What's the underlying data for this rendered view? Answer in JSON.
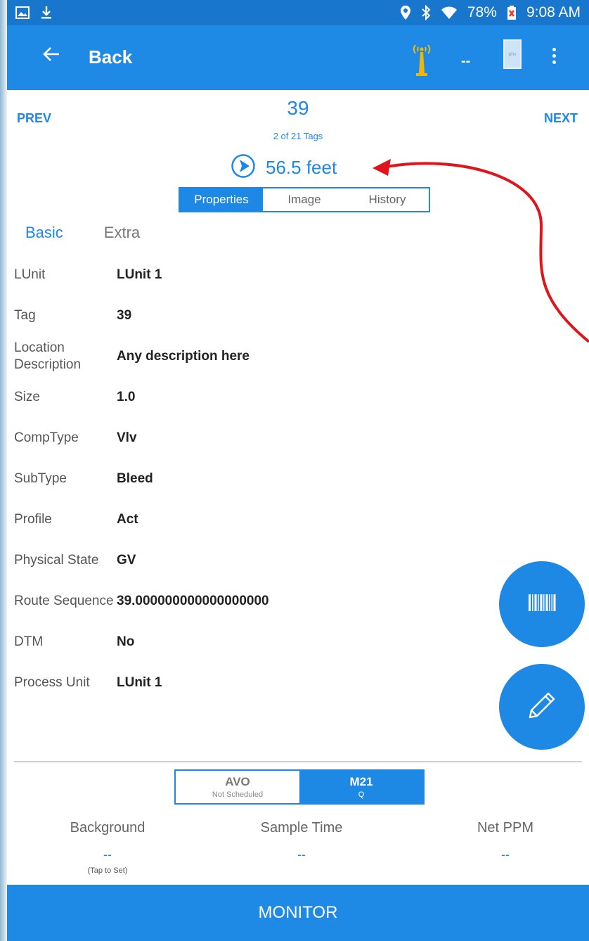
{
  "status": {
    "battery": "78%",
    "time": "9:08 AM"
  },
  "appbar": {
    "back_label": "Back",
    "signal_value": "--",
    "doc_label": "phx"
  },
  "navigator": {
    "prev_label": "PREV",
    "next_label": "NEXT",
    "tag_number": "39",
    "tag_count": "2 of 21 Tags",
    "distance": "56.5 feet"
  },
  "tabs": [
    {
      "label": "Properties",
      "active": true
    },
    {
      "label": "Image",
      "active": false
    },
    {
      "label": "History",
      "active": false
    }
  ],
  "subtabs": {
    "basic": "Basic",
    "extra": "Extra"
  },
  "properties": [
    {
      "label": "LUnit",
      "value": "LUnit 1"
    },
    {
      "label": "Tag",
      "value": "39"
    },
    {
      "label": "Location Description",
      "value": "Any description here"
    },
    {
      "label": "Size",
      "value": "1.0"
    },
    {
      "label": "CompType",
      "value": "Vlv"
    },
    {
      "label": "SubType",
      "value": "Bleed"
    },
    {
      "label": "Profile",
      "value": "Act"
    },
    {
      "label": "Physical State",
      "value": "GV"
    },
    {
      "label": "Route Sequence",
      "value": "39.000000000000000000"
    },
    {
      "label": "DTM",
      "value": "No"
    },
    {
      "label": "Process Unit",
      "value": "LUnit 1"
    }
  ],
  "methods": [
    {
      "name": "AVO",
      "sub": "Not Scheduled",
      "active": false
    },
    {
      "name": "M21",
      "sub": "Q",
      "active": true
    }
  ],
  "metrics": {
    "background_label": "Background",
    "background_value": "--",
    "background_hint": "(Tap to Set)",
    "sample_time_label": "Sample Time",
    "sample_time_value": "--",
    "net_ppm_label": "Net PPM",
    "net_ppm_value": "--"
  },
  "monitor_label": "MONITOR",
  "colors": {
    "primary": "#1e8ae6",
    "status_bar": "#1877cc",
    "annotation_arrow": "#e0141b",
    "antenna": "#f2b705"
  }
}
